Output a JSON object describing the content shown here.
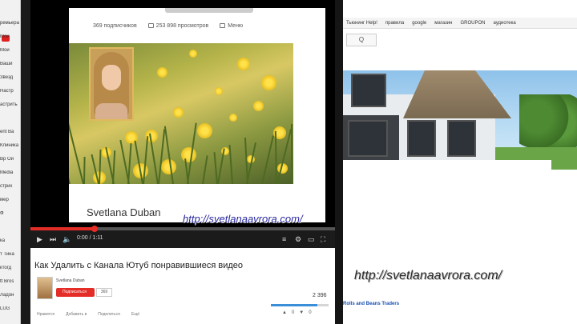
{
  "left_strip": {
    "labels": [
      "ремьера",
      "Мой",
      "Мой",
      "Ваши",
      "Звезд",
      "Настр",
      "астрить",
      "",
      "ent Ba",
      "Клиника",
      "Вр Ой",
      "Media",
      "стрих",
      "мер",
      "Ф",
      "",
      "ка",
      "т Тина",
      "ктогд",
      "tt Bros",
      "Ладон",
      "LUG"
    ]
  },
  "player": {
    "subscribers": "369 подписчиков",
    "views_total": "253 898 просмотров",
    "more": "Меню",
    "author_on_slide": "Svetlana Duban",
    "watermark_url": "http://svetlanaavrora.com/",
    "progress": 0.21,
    "time": "0:00 / 1:11"
  },
  "video": {
    "title": "Как Удалить с Канала Ютуб понравившиеся видео",
    "channel": "Svetlana Duban",
    "subscribe": "Подписаться",
    "sub_count": "369",
    "views": "2 396",
    "actions": [
      "Нравится",
      "Добавить в",
      "Поделиться",
      "Ещё"
    ],
    "likes": [
      "▲",
      "0",
      "▼",
      "0"
    ]
  },
  "right": {
    "bookmarks": [
      "Тьюнинг Help!",
      "правила",
      "google",
      "магазин",
      "GROUPON",
      "аудиотека"
    ],
    "search_button": "Q",
    "site_url": "http://svetlanaavrora.com/",
    "ad": "Rolls and Beans Traders"
  },
  "colors": {
    "accent_red": "#e52d27",
    "link_blue": "#2a2aa0"
  }
}
